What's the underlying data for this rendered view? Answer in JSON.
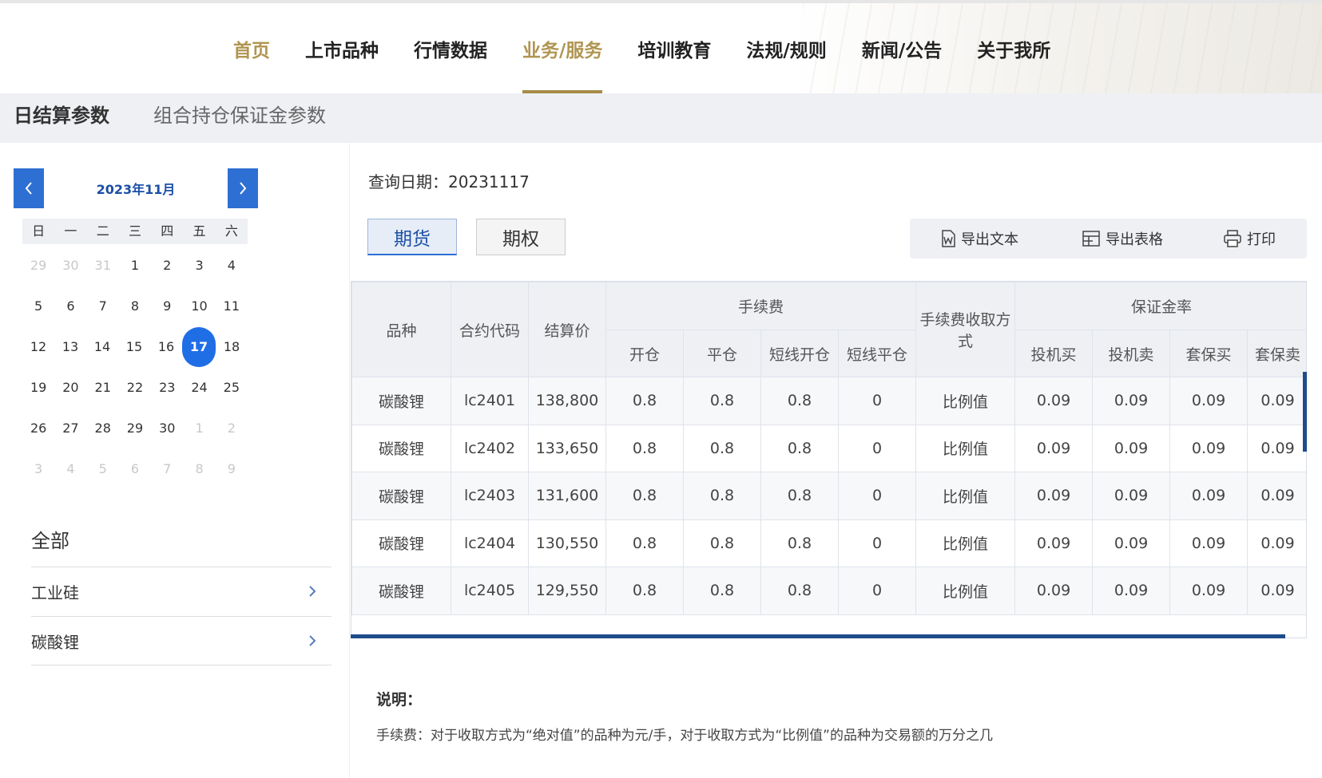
{
  "nav": {
    "items": [
      {
        "label": "首页"
      },
      {
        "label": "上市品种"
      },
      {
        "label": "行情数据"
      },
      {
        "label": "业务/服务"
      },
      {
        "label": "培训教育"
      },
      {
        "label": "法规/规则"
      },
      {
        "label": "新闻/公告"
      },
      {
        "label": "关于我所"
      }
    ],
    "active_index": 3,
    "accent_color": "#a88c48"
  },
  "subtabs": {
    "daily": "日结算参数",
    "combo": "组合持仓保证金参数"
  },
  "calendar": {
    "month_label": "2023年11月",
    "weekdays": [
      "日",
      "一",
      "二",
      "三",
      "四",
      "五",
      "六"
    ],
    "weeks": [
      [
        "29",
        "30",
        "31",
        "1",
        "2",
        "3",
        "4"
      ],
      [
        "5",
        "6",
        "7",
        "8",
        "9",
        "10",
        "11"
      ],
      [
        "12",
        "13",
        "14",
        "15",
        "16",
        "17",
        "18"
      ],
      [
        "19",
        "20",
        "21",
        "22",
        "23",
        "24",
        "25"
      ],
      [
        "26",
        "27",
        "28",
        "29",
        "30",
        "1",
        "2"
      ],
      [
        "3",
        "4",
        "5",
        "6",
        "7",
        "8",
        "9"
      ]
    ],
    "selected": "17",
    "accent_color": "#1f6ee6"
  },
  "categories": {
    "title": "全部",
    "items": [
      {
        "label": "工业硅"
      },
      {
        "label": "碳酸锂"
      }
    ]
  },
  "query": {
    "label": "查询日期：",
    "date": "20231117"
  },
  "tabs": {
    "futures": "期货",
    "options": "期权"
  },
  "toolbar": {
    "export_text": "导出文本",
    "export_table": "导出表格",
    "print": "打印"
  },
  "table": {
    "headers": {
      "variety": "品种",
      "contract": "合约代码",
      "settle": "结算价",
      "fee_group": "手续费",
      "open": "开仓",
      "close": "平仓",
      "short_open": "短线开仓",
      "short_close": "短线平仓",
      "fee_method": "手续费收取方式",
      "margin_group": "保证金率",
      "spec_buy": "投机买",
      "spec_sell": "投机卖",
      "hedge_buy": "套保买",
      "hedge_sell": "套保卖"
    },
    "rows": [
      [
        "碳酸锂",
        "lc2401",
        "138,800",
        "0.8",
        "0.8",
        "0.8",
        "0",
        "比例值",
        "0.09",
        "0.09",
        "0.09",
        "0.09"
      ],
      [
        "碳酸锂",
        "lc2402",
        "133,650",
        "0.8",
        "0.8",
        "0.8",
        "0",
        "比例值",
        "0.09",
        "0.09",
        "0.09",
        "0.09"
      ],
      [
        "碳酸锂",
        "lc2403",
        "131,600",
        "0.8",
        "0.8",
        "0.8",
        "0",
        "比例值",
        "0.09",
        "0.09",
        "0.09",
        "0.09"
      ],
      [
        "碳酸锂",
        "lc2404",
        "130,550",
        "0.8",
        "0.8",
        "0.8",
        "0",
        "比例值",
        "0.09",
        "0.09",
        "0.09",
        "0.09"
      ],
      [
        "碳酸锂",
        "lc2405",
        "129,550",
        "0.8",
        "0.8",
        "0.8",
        "0",
        "比例值",
        "0.09",
        "0.09",
        "0.09",
        "0.09"
      ]
    ]
  },
  "note": {
    "title": "说明：",
    "text": "手续费：对于收取方式为“绝对值”的品种为元/手，对于收取方式为“比例值”的品种为交易额的万分之几"
  }
}
